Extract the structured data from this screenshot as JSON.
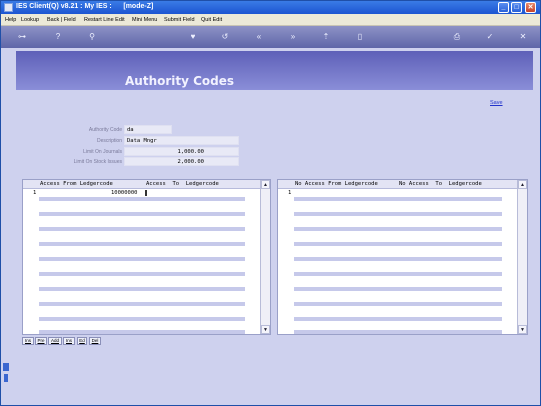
{
  "window": {
    "title": "IES Client(Q) v8.21 : My IES :      [mode-Z]",
    "minimize": "_",
    "maximize": "□",
    "close": "✕"
  },
  "menu": {
    "items": [
      "Help",
      "Lookup",
      "Back | Field",
      "Restart Line Edit",
      "Mini Menu",
      "Submit Field",
      "Quit Edit"
    ]
  },
  "toolbar": {
    "icons": [
      "key-icon",
      "help-icon",
      "search-icon",
      "heart-icon",
      "undo-icon",
      "rewind-icon",
      "forward-icon",
      "upload-icon",
      "trash-icon",
      "print-icon",
      "check-icon",
      "close-icon"
    ]
  },
  "page": {
    "title": "Authority Codes",
    "save_link": "Save"
  },
  "form": {
    "authority_code_label": "Authority Code",
    "authority_code_value": "da",
    "description_label": "Description",
    "description_value": "Data Mngr",
    "limit_journals_label": "Limit On Journals",
    "limit_journals_value": "1,000.00",
    "limit_stock_issues_label": "Limit On Stock Issues",
    "limit_stock_issues_value": "2,000.00"
  },
  "grid_access": {
    "col_from": "Access From Ledgercode",
    "col_to": "Access  To  Ledgercode",
    "rows": [
      {
        "num": "1",
        "from": "10000000",
        "to": ""
      }
    ]
  },
  "grid_noaccess": {
    "col_from": "No Access From Ledgercode",
    "col_to": "No Access  To  Ledgercode",
    "rows": [
      {
        "num": "1",
        "from": "",
        "to": ""
      }
    ]
  },
  "row_buttons": {
    "ins": "Ins",
    "pre": "Pre",
    "add": "Add",
    "ins2": "Ins",
    "ed": "Ed",
    "del": "Del"
  }
}
